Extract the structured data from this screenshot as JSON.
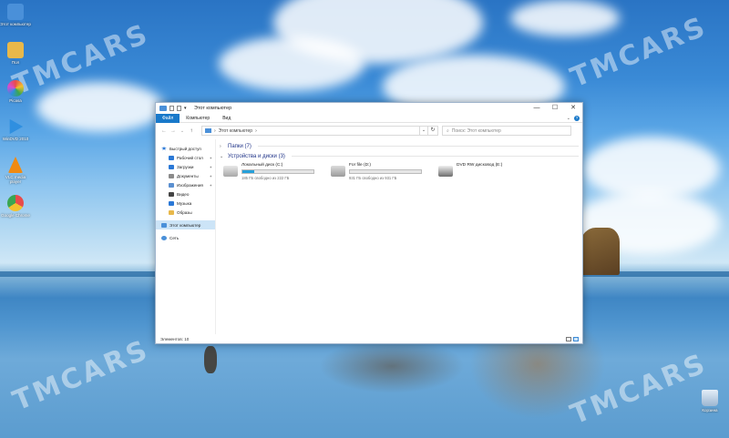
{
  "desktop": {
    "icons": [
      {
        "name": "this-pc",
        "label": "Этот компьютер",
        "color": "#4a90d9"
      },
      {
        "name": "user-folder",
        "label": "Пол",
        "color": "#e8b84a"
      },
      {
        "name": "picasa",
        "label": "Picasa",
        "color": "#d84bd1"
      },
      {
        "name": "windvd",
        "label": "WinDVD 2010",
        "color": "#2f8fe0"
      },
      {
        "name": "vlc",
        "label": "VLC media player",
        "color": "#f08a12"
      },
      {
        "name": "chrome",
        "label": "Google Chrome",
        "color": "#3aa651"
      }
    ],
    "recycle_bin": {
      "label": "Корзина"
    },
    "watermark": "TMCARS"
  },
  "window": {
    "title": "Этот компьютер",
    "controls": {
      "minimize": "—",
      "maximize": "☐",
      "close": "✕"
    }
  },
  "ribbon": {
    "tabs": [
      {
        "label": "Файл",
        "active": true
      },
      {
        "label": "Компьютер",
        "active": false
      },
      {
        "label": "Вид",
        "active": false
      }
    ],
    "help": "?"
  },
  "address_bar": {
    "path": "Этот компьютер",
    "separator": "›",
    "search_placeholder": "Поиск: Этот компьютер"
  },
  "sidebar": {
    "items": [
      {
        "label": "Быстрый доступ",
        "icon": "star-icon",
        "color": "#2a78d6",
        "pinned": false,
        "sub": false
      },
      {
        "label": "Рабочий стол",
        "icon": "desktop-icon",
        "color": "#2a78d6",
        "pinned": true,
        "sub": true
      },
      {
        "label": "Загрузки",
        "icon": "download-icon",
        "color": "#2a78d6",
        "pinned": true,
        "sub": true
      },
      {
        "label": "Документы",
        "icon": "document-icon",
        "color": "#8a8a8a",
        "pinned": true,
        "sub": true
      },
      {
        "label": "Изображения",
        "icon": "image-icon",
        "color": "#5a8fd0",
        "pinned": true,
        "sub": true
      },
      {
        "label": "Видео",
        "icon": "video-icon",
        "color": "#444444",
        "pinned": false,
        "sub": true
      },
      {
        "label": "Музыка",
        "icon": "music-icon",
        "color": "#2a78d6",
        "pinned": false,
        "sub": true
      },
      {
        "label": "Образы",
        "icon": "folder-icon",
        "color": "#e8b84a",
        "pinned": false,
        "sub": true
      },
      {
        "label": "Этот компьютер",
        "icon": "computer-icon",
        "color": "#4a90d9",
        "pinned": false,
        "sub": false,
        "selected": true
      },
      {
        "label": "Сеть",
        "icon": "network-icon",
        "color": "#4a90d9",
        "pinned": false,
        "sub": false
      }
    ]
  },
  "content": {
    "folders_group": "Папки (7)",
    "devices_group": "Устройства и диски (3)",
    "drives": [
      {
        "name": "Локальный диск (C:)",
        "free": "185 ГБ свободно из 222 ГБ",
        "used_fraction": 0.17,
        "type": "hdd"
      },
      {
        "name": "For file (D:)",
        "free": "931 ГБ свободно из 931 ГБ",
        "used_fraction": 0.0,
        "type": "hdd"
      },
      {
        "name": "DVD RW дисковод (E:)",
        "free": "",
        "used_fraction": null,
        "type": "dvd"
      }
    ]
  },
  "statusbar": {
    "items_count": "Элементов: 10"
  }
}
